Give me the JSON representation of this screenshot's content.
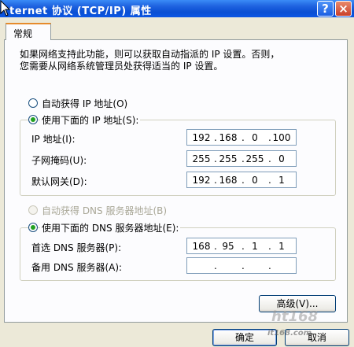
{
  "window": {
    "title": "ternet 协议 (TCP/IP) 属性",
    "help": "?",
    "close": "×"
  },
  "tab": {
    "label": "常规"
  },
  "description": "如果网络支持此功能，则可以获取自动指派的 IP 设置。否则，\n您需要从网络系统管理员处获得适当的 IP 设置。",
  "ip_section": {
    "auto_label": "自动获得 IP 地址(O)",
    "manual_label": "使用下面的 IP 地址(S):",
    "selected": "manual",
    "fields": [
      {
        "label": "IP 地址(I):",
        "octets": [
          "192",
          "168",
          "0",
          "100"
        ]
      },
      {
        "label": "子网掩码(U):",
        "octets": [
          "255",
          "255",
          "255",
          "0"
        ]
      },
      {
        "label": "默认网关(D):",
        "octets": [
          "192",
          "168",
          "0",
          "1"
        ]
      }
    ]
  },
  "dns_section": {
    "auto_label": "自动获得 DNS 服务器地址(B)",
    "manual_label": "使用下面的 DNS 服务器地址(E):",
    "selected": "manual",
    "fields": [
      {
        "label": "首选 DNS 服务器(P):",
        "octets": [
          "168",
          "95",
          "1",
          "1"
        ]
      },
      {
        "label": "备用 DNS 服务器(A):",
        "octets": [
          "",
          "",
          "",
          ""
        ]
      }
    ]
  },
  "buttons": {
    "advanced": "高级(V)...",
    "ok": "确定",
    "cancel": "取消"
  },
  "watermark": {
    "brand": "ht168",
    "site": "it168.com"
  },
  "colors": {
    "title_bar": "#0a4fd3",
    "dialog_bg": "#ece9d8",
    "radio_dot": "#21a121",
    "input_border": "#7f9db9"
  }
}
